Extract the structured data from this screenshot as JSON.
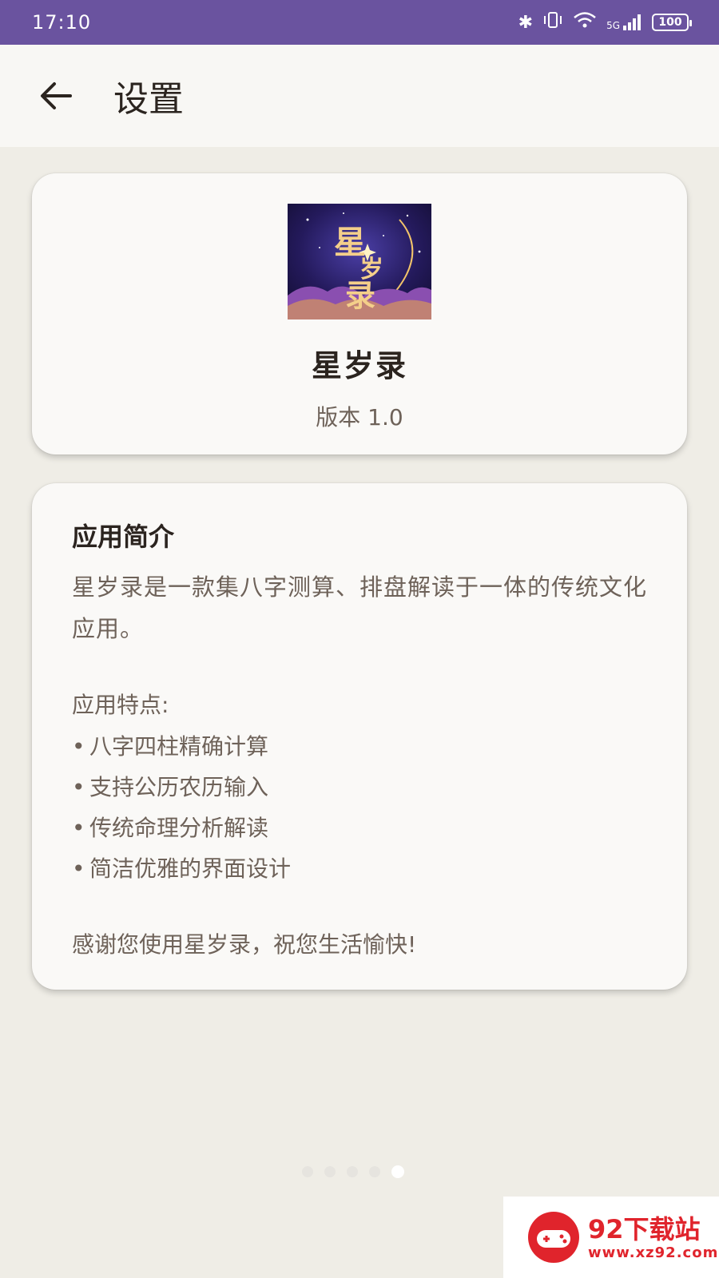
{
  "status_bar": {
    "time": "17:10",
    "battery": "100",
    "network": "5G"
  },
  "header": {
    "title": "设置"
  },
  "app_card": {
    "name": "星岁录",
    "version": "版本 1.0",
    "logo_text": "星岁录"
  },
  "about": {
    "heading": "应用简介",
    "description": "星岁录是一款集八字测算、排盘解读于一体的传统文化应用。",
    "features_title": "应用特点:",
    "features": [
      "八字四柱精确计算",
      "支持公历农历输入",
      "传统命理分析解读",
      "简洁优雅的界面设计"
    ],
    "thanks": "感谢您使用星岁录，祝您生活愉快!"
  },
  "pager": {
    "count": 5,
    "active_index": 4
  },
  "watermark": {
    "title": "92下载站",
    "url": "www.xz92.com"
  },
  "colors": {
    "status_bar": "#6a539f",
    "background": "#efede6",
    "card": "#faf9f7",
    "watermark": "#e0242c"
  }
}
